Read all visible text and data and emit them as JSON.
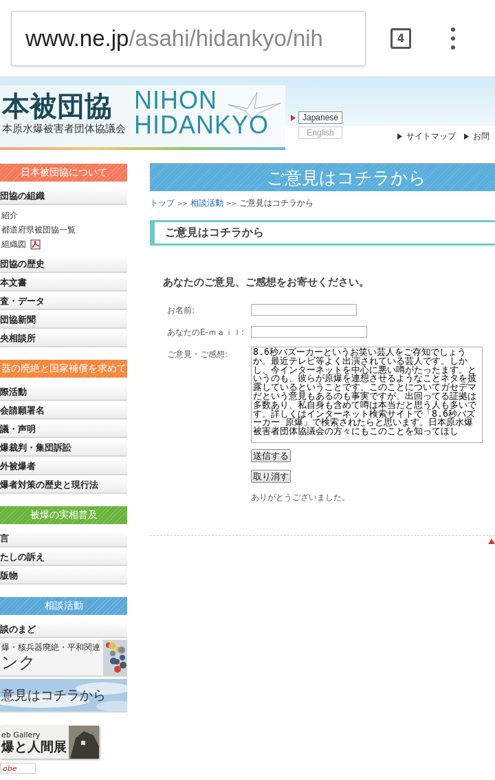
{
  "browser": {
    "url_host": "www.ne.jp",
    "url_path": "/asahi/hidankyo/nih",
    "tab_count": "4"
  },
  "header": {
    "logo_title": "本被団協",
    "logo_subtitle": "本原水爆被害者団体協議会",
    "brand_lines": [
      "NIHON",
      "HIDANKYO"
    ],
    "languages": [
      {
        "label": "Japanese",
        "selected": true
      },
      {
        "label": "English",
        "selected": false
      }
    ],
    "links": [
      "サイトマップ",
      "お問"
    ]
  },
  "sidebar": {
    "sections": [
      {
        "title": "日本被団協について",
        "color": "#f47a5a",
        "items": [
          {
            "kind": "tab",
            "label": "団協の組織"
          },
          {
            "kind": "sub",
            "label": "紹介"
          },
          {
            "kind": "sub",
            "label": "都道府県被団協一覧"
          },
          {
            "kind": "sub-pdf",
            "label": "組織図"
          },
          {
            "kind": "tab",
            "label": "団協の歴史"
          },
          {
            "kind": "tab",
            "label": "本文書"
          },
          {
            "kind": "tab",
            "label": "査・データ"
          },
          {
            "kind": "tab",
            "label": "団協新聞"
          },
          {
            "kind": "tab",
            "label": "央相談所"
          }
        ]
      },
      {
        "title": "器の廃絶と国家補償を求めて",
        "color": "#f6853a",
        "items": [
          {
            "kind": "tab",
            "label": "際活動"
          },
          {
            "kind": "tab",
            "label": "会請願署名"
          },
          {
            "kind": "tab",
            "label": "議・声明"
          },
          {
            "kind": "tab",
            "label": "爆裁判・集団訴訟"
          },
          {
            "kind": "tab",
            "label": "外被爆者"
          },
          {
            "kind": "tab",
            "label": "爆者対策の歴史と現行法"
          }
        ]
      },
      {
        "title": "被爆の実相普及",
        "color": "#6ab43c",
        "items": [
          {
            "kind": "tab",
            "label": "言"
          },
          {
            "kind": "tab",
            "label": "たしの訴え"
          },
          {
            "kind": "tab",
            "label": "版物"
          }
        ]
      },
      {
        "title": "相談活動",
        "color": "#5aa8d8",
        "items": [
          {
            "kind": "tab",
            "label": "談のまど"
          },
          {
            "kind": "crowd-banner",
            "lines": [
              "爆・核兵器廃絶・平和関連",
              "ンク"
            ]
          },
          {
            "kind": "sky-banner",
            "lines": [
              "意見はコチラから"
            ]
          }
        ]
      }
    ],
    "gallery": {
      "lines": [
        "eb Gallery",
        "爆と人間展"
      ]
    },
    "badge": "obe"
  },
  "main": {
    "title_banner": "ご意見はコチラから",
    "breadcrumb": [
      {
        "label": "トップ",
        "link": true
      },
      {
        "label": "相談活動",
        "link": true
      },
      {
        "label": "ご意見はコチラから",
        "link": false
      }
    ],
    "breadcrumb_separator": ">>",
    "heading": "ご意見はコチラから",
    "intro": "あなたのご意見、ご感想をお寄せください。",
    "fields": [
      {
        "kind": "text",
        "label": "お名前:"
      },
      {
        "kind": "text",
        "label": "あなたのE-ｍａｉｌ:"
      },
      {
        "kind": "textarea",
        "label": "ご意見・ご感想:",
        "value": "8.6秒バズーカーというお笑い芸人をご存知でしょうか。最近テレビ等よく出演されている芸人です。しかし、今インターネットを中心に悪い噂がたったます。というのも、彼らが原爆を連想させるようなことネタを披露しているということです。このことについてガセデマだという意見もあるのも事実ですが、出回ってる証拠は多数あり、私自身も含めて噂は本当だと思う人も多いです。詳しくはインターネット検索サイトで「8.6秒バズーカー 原爆」で検索されたらと思います。日本原水爆被害者団体協議会の方々にもこのことを知ってほし"
      }
    ],
    "buttons": [
      "送信する",
      "取り消す"
    ],
    "thanks": "ありがとうございました。"
  }
}
